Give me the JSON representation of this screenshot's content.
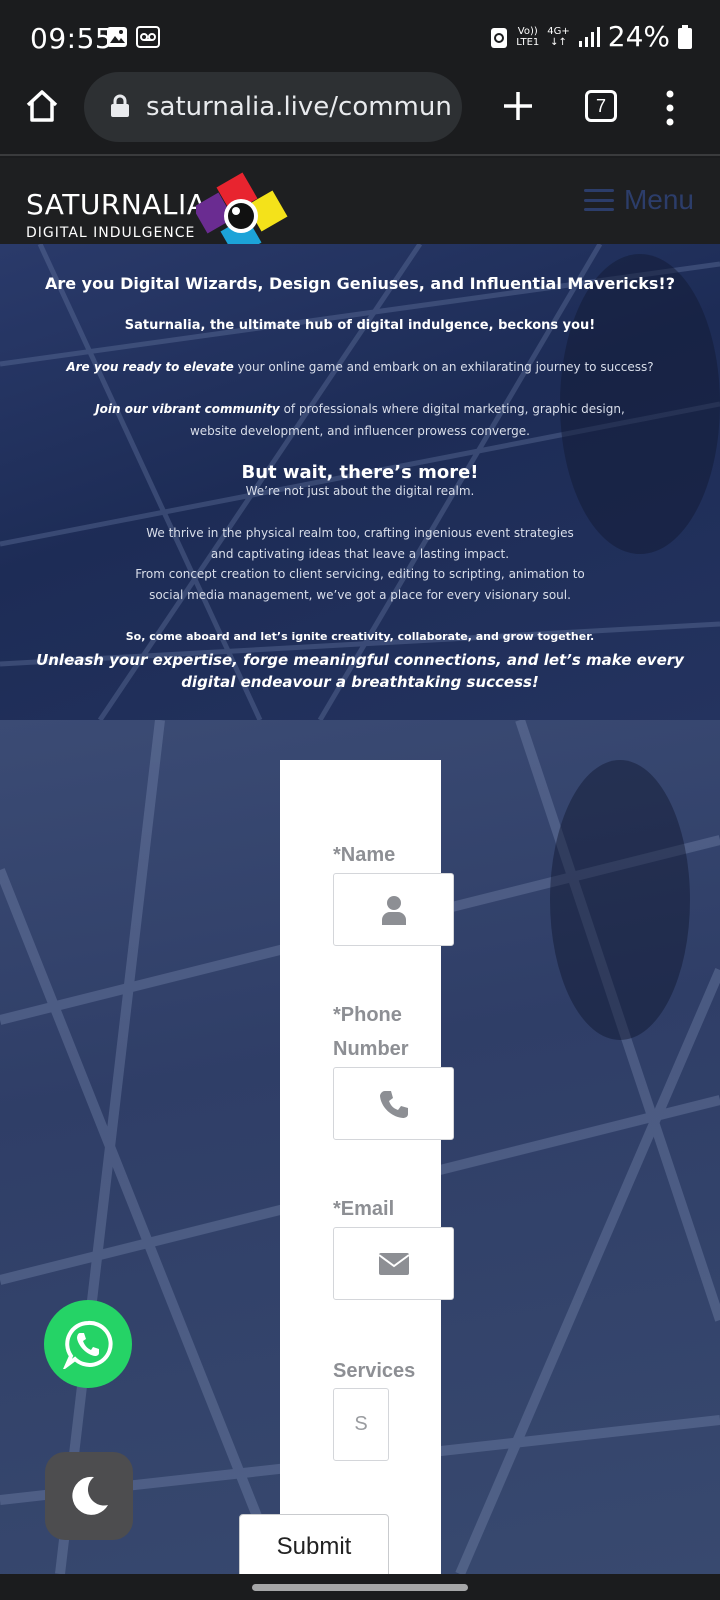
{
  "status_bar": {
    "time": "09:55",
    "network_top": "Vo))",
    "network_bottom": "LTE1",
    "net_type_top": "4G+",
    "net_type_bottom": "↓↑",
    "battery": "24%"
  },
  "browser": {
    "url": "saturnalia.live/commun",
    "tab_count": "7"
  },
  "site": {
    "logo_title": "SATURNALIA",
    "logo_subtitle": "DIGITAL INDULGENCE",
    "menu_label": "Menu",
    "brand_colors": [
      "#e8242f",
      "#f4e21a",
      "#6a2c91",
      "#1ca3d8"
    ]
  },
  "hero": {
    "line1": "Are you Digital Wizards, Design Geniuses, and Influential Mavericks!?",
    "line2": "Saturnalia, the ultimate hub of digital indulgence, beckons you!",
    "line3_em": "Are you ready to elevate",
    "line3_rest": " your online game and embark on an exhilarating journey to success?",
    "line4_em": "Join our vibrant community",
    "line4_rest": " of professionals where digital marketing, graphic design,",
    "line5": "website development, and influencer prowess converge.",
    "heading": "But wait, there’s more!",
    "line6": "We’re not just about the digital realm.",
    "line7": "We thrive in the physical realm too, crafting ingenious event strategies",
    "line8": "and captivating ideas that leave a lasting impact.",
    "line9": "From concept creation to client servicing, editing to scripting, animation to",
    "line10": "social media management, we’ve got a place for every visionary soul.",
    "line11": "So, come aboard and let’s ignite creativity, collaborate, and grow together.",
    "line12": "Unleash your expertise, forge meaningful connections, and let’s make every",
    "line13": "digital endeavour a breathtaking success!"
  },
  "form": {
    "name_label": "*Name",
    "phone_label_1": "*Phone",
    "phone_label_2": "Number",
    "email_label": "*Email",
    "services_label": "Services",
    "services_value": "S",
    "submit_label": "Submit"
  }
}
